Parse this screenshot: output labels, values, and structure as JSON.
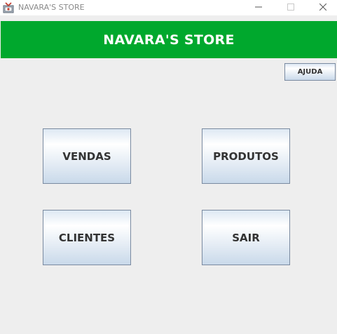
{
  "window": {
    "title": "NAVARA'S STORE",
    "icon": "java-app-icon",
    "controls": [
      "minimize",
      "maximize",
      "close"
    ]
  },
  "header": {
    "title": "NAVARA'S STORE",
    "background_color": "#00a82d"
  },
  "toolbar": {
    "help_label": "AJUDA"
  },
  "menu": {
    "vendas_label": "VENDAS",
    "produtos_label": "PRODUTOS",
    "clientes_label": "CLIENTES",
    "sair_label": "SAIR"
  }
}
